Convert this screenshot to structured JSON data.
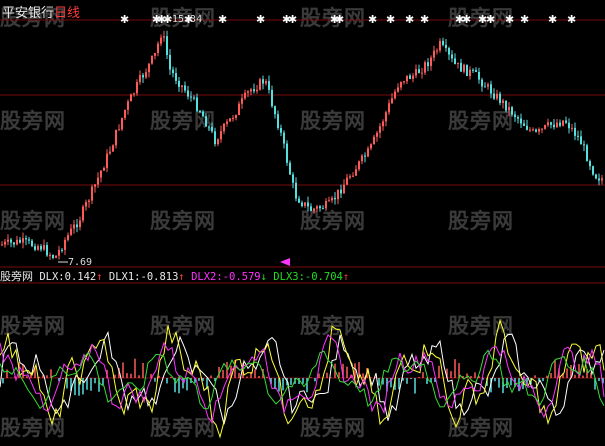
{
  "header": {
    "stock_name": "平安银行",
    "period": "日线"
  },
  "price_chart": {
    "high_label": "15.34",
    "low_label": "7.69"
  },
  "indicator": {
    "source": "股旁网",
    "dlx": {
      "label": "DLX:",
      "value": "0.142",
      "arrow": "↑",
      "color": "#e8e8e8"
    },
    "dlx1": {
      "label": "DLX1:",
      "value": "-0.813",
      "arrow": "↑",
      "color": "#e8e8e8"
    },
    "dlx2": {
      "label": "DLX2:",
      "value": "-0.579",
      "arrow": "↓",
      "color": "#ff33ff"
    },
    "dlx3": {
      "label": "DLX3:",
      "value": "-0.704",
      "arrow": "↑",
      "color": "#22dd22"
    }
  },
  "watermark": "股旁网",
  "colors": {
    "up": "#ff5a5a",
    "down": "#55e0e0",
    "grid": "#7a0a0a",
    "signal": "#ffffff",
    "yellow": "#ffff33",
    "magenta": "#ff33ff",
    "green": "#33dd33"
  }
}
